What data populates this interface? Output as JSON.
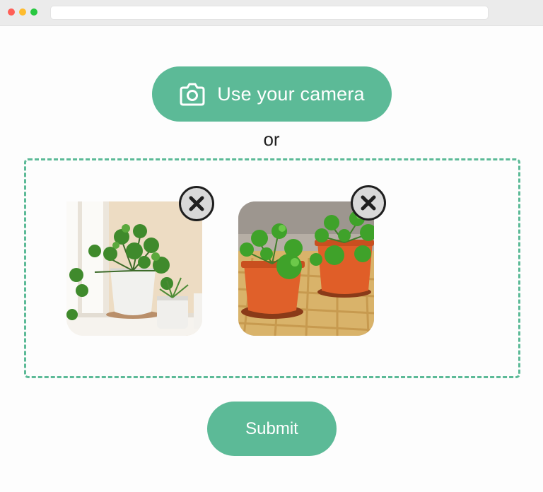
{
  "camera_button": {
    "label": "Use your camera",
    "icon": "camera-icon"
  },
  "separator": {
    "text": "or"
  },
  "dropzone": {
    "border_color": "#5cba97",
    "images": [
      {
        "subject": "potted pilea plant in white pot on windowsill",
        "remove_icon": "close-icon"
      },
      {
        "subject": "two pilea plants in orange terracotta pots on woven mat",
        "remove_icon": "close-icon"
      }
    ]
  },
  "submit_button": {
    "label": "Submit"
  },
  "colors": {
    "accent": "#5cba97",
    "text": "#222222",
    "button_text": "#ffffff"
  }
}
